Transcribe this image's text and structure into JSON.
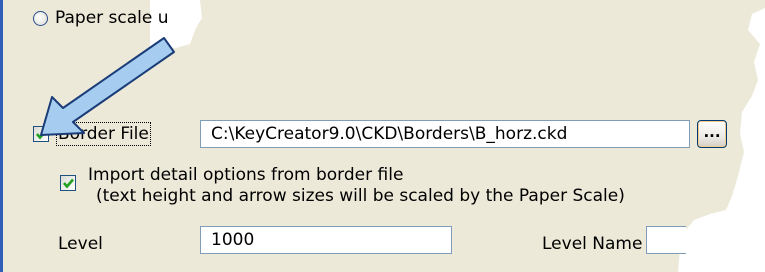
{
  "options": {
    "paper_scale_label": "Paper scale u",
    "border_file_label": "Border File",
    "border_file_path": "C:\\KeyCreator9.0\\CKD\\Borders\\B_horz.ckd",
    "browse_label": "...",
    "import_detail_line1": "Import detail options from border file",
    "import_detail_line2": "(text height and arrow sizes will be scaled by the Paper Scale)",
    "level_label": "Level",
    "level_value": "1000",
    "level_name_label": "Level Name",
    "level_name_value": ""
  },
  "state": {
    "paper_scale_selected": false,
    "border_file_checked": true,
    "import_detail_checked": true
  },
  "colors": {
    "panel": "#ece9d8",
    "arrow_fill": "#a6cdf0",
    "arrow_stroke": "#1a3c78",
    "check": "#21a121",
    "edge": "#2f5fb8"
  },
  "annotation_arrow_icon": "arrow-pointer-icon"
}
